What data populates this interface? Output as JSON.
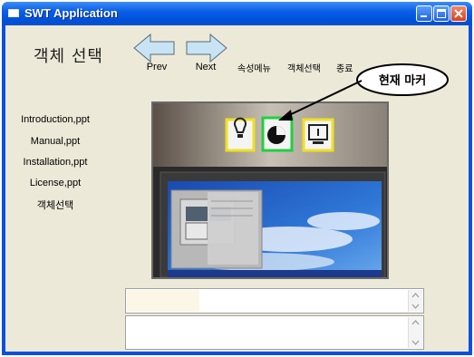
{
  "window": {
    "title": "SWT Application"
  },
  "header": {
    "title": "객체 선택"
  },
  "toolbar": {
    "prev_label": "Prev",
    "next_label": "Next"
  },
  "menu": {
    "items": [
      "속성메뉴",
      "객체선택",
      "종료"
    ]
  },
  "callout": {
    "label": "현재 마커"
  },
  "file_list": {
    "items": [
      "Introduction,ppt",
      "Manual,ppt",
      "Installation,ppt",
      "License,ppt",
      "객체선택"
    ]
  },
  "colors": {
    "titlebar": "#0a5fe8",
    "client_bg": "#ece9d8",
    "marker_yellow": "#f0e020",
    "marker_green": "#20d040"
  },
  "icons": [
    "prev-arrow-icon",
    "next-arrow-icon",
    "lightbulb-marker-icon",
    "piechart-marker-icon",
    "monitor-marker-icon"
  ]
}
